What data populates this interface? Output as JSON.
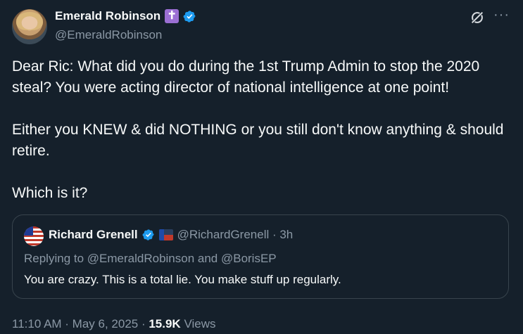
{
  "author": {
    "display_name": "Emerald Robinson",
    "badge_glyph": "✝",
    "handle": "@EmeraldRobinson"
  },
  "tweet": {
    "paragraphs": [
      "Dear Ric: What did you do during the 1st Trump Admin to stop the 2020 steal? You were acting director of national intelligence at one point!",
      "Either you KNEW & did NOTHING or you still don't know anything & should retire.",
      "Which is it?"
    ]
  },
  "quoted": {
    "display_name": "Richard Grenell",
    "handle_time": "@RichardGrenell · 3h",
    "replying_to": "Replying to @EmeraldRobinson and @BorisEP",
    "text": "You are crazy. This is a total lie. You make stuff up regularly."
  },
  "meta": {
    "timestamp": "11:10 AM · May 6, 2025 · ",
    "views_count": "15.9K",
    "views_label": " Views"
  },
  "icons": {
    "verified": "verified-badge-icon",
    "grok": "grok-icon",
    "more": "more-options-icon"
  },
  "colors": {
    "background": "#15202b",
    "verified_blue": "#1d9bf0",
    "muted": "#8b98a5"
  }
}
